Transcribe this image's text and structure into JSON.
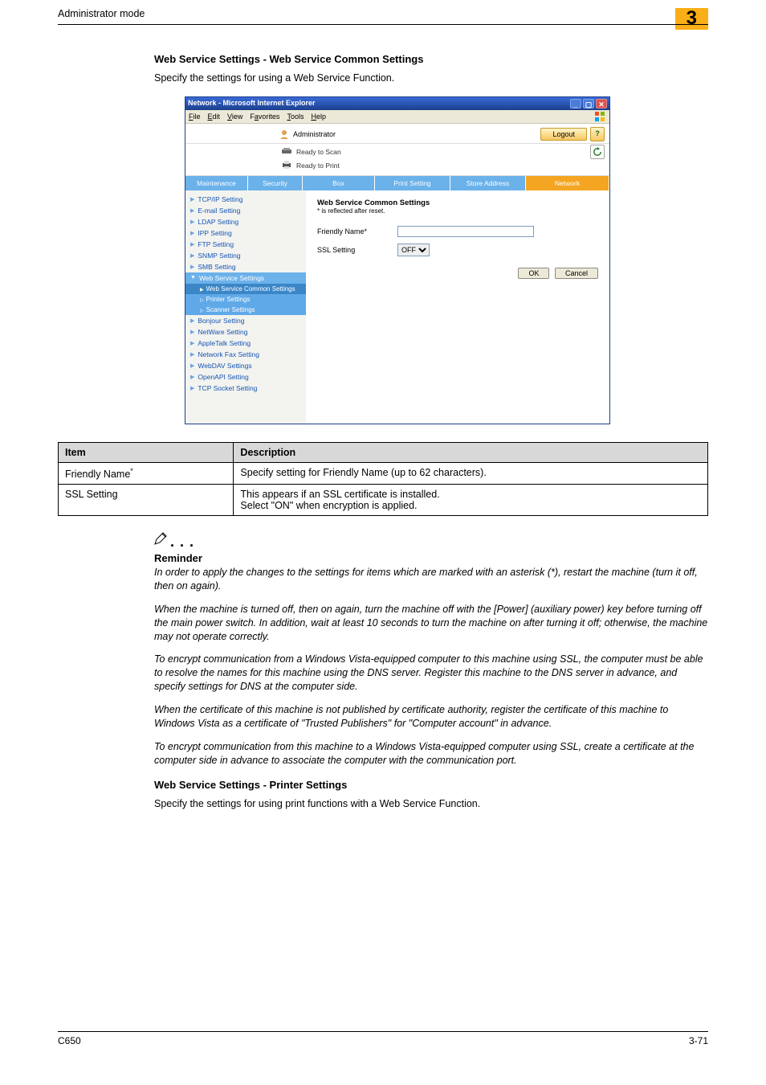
{
  "header": {
    "mode": "Administrator mode",
    "chapter": "3"
  },
  "section": {
    "title1": "Web Service Settings - Web Service Common Settings",
    "intro1": "Specify the settings for using a Web Service Function.",
    "title2": "Web Service Settings - Printer Settings",
    "intro2": "Specify the settings for using print functions with a Web Service Function."
  },
  "ie": {
    "title": "Network - Microsoft Internet Explorer",
    "menu": {
      "file": "File",
      "edit": "Edit",
      "view": "View",
      "favorites": "Favorites",
      "tools": "Tools",
      "help": "Help"
    },
    "admin_label": "Administrator",
    "logout": "Logout",
    "status": {
      "scan": "Ready to Scan",
      "print": "Ready to Print"
    },
    "tabs": {
      "maintenance": "Maintenance",
      "security": "Security",
      "box": "Box",
      "print": "Print Setting",
      "store": "Store Address",
      "network": "Network"
    },
    "side": {
      "tcpip": "TCP/IP Setting",
      "email": "E-mail Setting",
      "ldap": "LDAP Setting",
      "ipp": "IPP Setting",
      "ftp": "FTP Setting",
      "snmp": "SNMP Setting",
      "smb": "SMB Setting",
      "web": "Web Service Settings",
      "web_common": "Web Service Common Settings",
      "web_printer": "Printer Settings",
      "web_scanner": "Scanner Settings",
      "bonjour": "Bonjour Setting",
      "netware": "NetWare Setting",
      "appletalk": "AppleTalk Setting",
      "netfax": "Network Fax Setting",
      "webdav": "WebDAV Settings",
      "openapi": "OpenAPI Setting",
      "tcpsocket": "TCP Socket Setting"
    },
    "pane": {
      "title": "Web Service Common Settings",
      "note": "* is reflected after reset.",
      "friendly": "Friendly Name*",
      "ssl": "SSL Setting",
      "ssl_value": "OFF",
      "ok": "OK",
      "cancel": "Cancel"
    }
  },
  "table": {
    "head_item": "Item",
    "head_desc": "Description",
    "r1_item": "Friendly Name",
    "r1_desc": "Specify setting for Friendly Name (up to 62 characters).",
    "r2_item": "SSL Setting",
    "r2_desc": "This appears if an SSL certificate is installed.\nSelect \"ON\" when encryption is applied."
  },
  "reminder": {
    "title": "Reminder",
    "p1": "In order to apply the changes to the settings for items which are marked with an asterisk (*), restart the machine (turn it off, then on again).",
    "p2": "When the machine is turned off, then on again, turn the machine off with the [Power] (auxiliary power) key before turning off the main power switch. In addition, wait at least 10 seconds to turn the machine on after turning it off; otherwise, the machine may not operate correctly.",
    "p3": "To encrypt communication from a Windows Vista-equipped computer to this machine using SSL, the computer must be able to resolve the names for this machine using the DNS server. Register this machine to the DNS server in advance, and specify settings for DNS at the computer side.",
    "p4": "When the certificate of this machine is not published by certificate authority, register the certificate of this machine to Windows Vista as a certificate of \"Trusted Publishers\" for \"Computer account\" in advance.",
    "p5": "To encrypt communication from this machine to a Windows Vista-equipped computer using SSL, create a certificate at the computer side in advance to associate the computer with the communication port."
  },
  "footer": {
    "left": "C650",
    "right": "3-71"
  }
}
